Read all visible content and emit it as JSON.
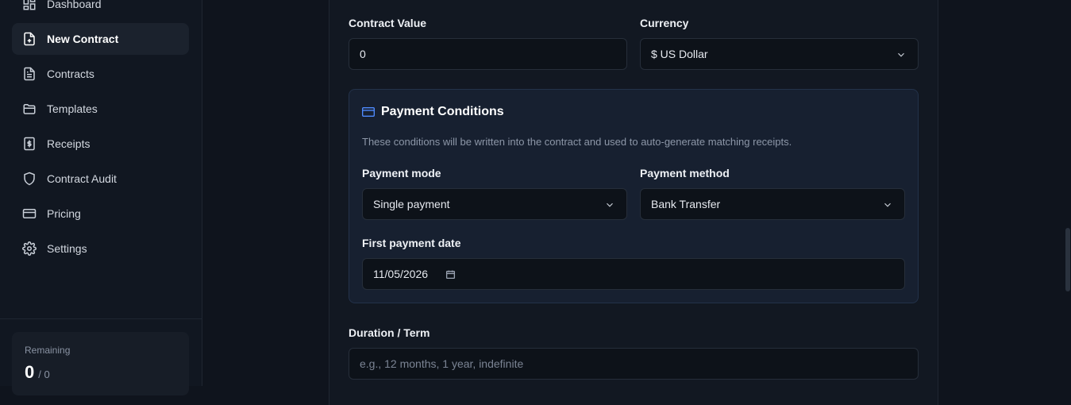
{
  "sidebar": {
    "items": [
      {
        "label": "Dashboard",
        "icon": "dashboard-icon"
      },
      {
        "label": "New Contract",
        "icon": "file-plus-icon",
        "active": true
      },
      {
        "label": "Contracts",
        "icon": "file-text-icon"
      },
      {
        "label": "Templates",
        "icon": "folder-icon"
      },
      {
        "label": "Receipts",
        "icon": "receipt-dollar-icon"
      },
      {
        "label": "Contract Audit",
        "icon": "shield-icon"
      },
      {
        "label": "Pricing",
        "icon": "credit-card-icon"
      },
      {
        "label": "Settings",
        "icon": "gear-icon"
      }
    ],
    "usage": {
      "label": "Remaining",
      "count": "0",
      "total": "/ 0"
    }
  },
  "form": {
    "contract_value": {
      "label": "Contract Value",
      "value": "0"
    },
    "currency": {
      "label": "Currency",
      "value": "$ US Dollar"
    },
    "payment": {
      "title": "Payment Conditions",
      "description": "These conditions will be written into the contract and used to auto-generate matching receipts.",
      "mode": {
        "label": "Payment mode",
        "value": "Single payment"
      },
      "method": {
        "label": "Payment method",
        "value": "Bank Transfer"
      },
      "first_date": {
        "label": "First payment date",
        "value": "11/05/2026"
      }
    },
    "duration": {
      "label": "Duration / Term",
      "placeholder": "e.g., 12 months, 1 year, indefinite"
    }
  },
  "colors": {
    "accent": "#4f8bff",
    "background": "#0f141d",
    "panel": "#172030"
  }
}
